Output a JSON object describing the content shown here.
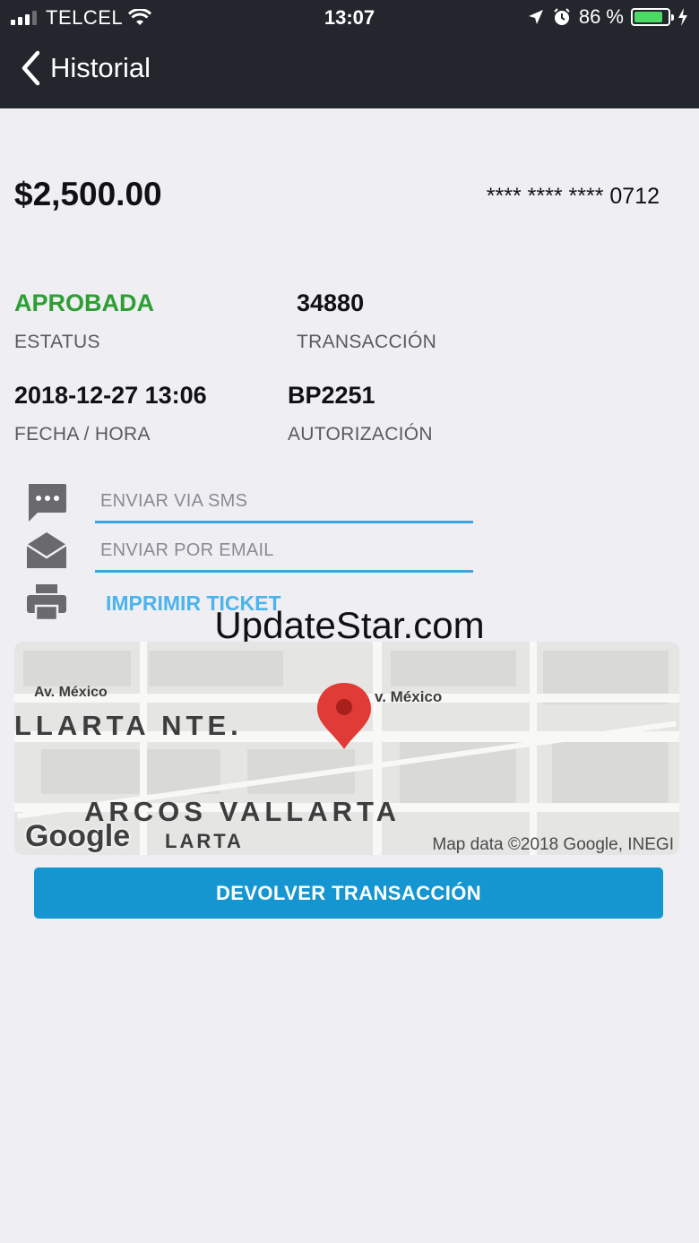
{
  "status_bar": {
    "carrier": "TELCEL",
    "time": "13:07",
    "battery": "86 %"
  },
  "nav": {
    "back_label": "Historial"
  },
  "transaction": {
    "amount": "$2,500.00",
    "card": "**** **** **** 0712",
    "status_value": "APROBADA",
    "status_caption": "ESTATUS",
    "transaction_value": "34880",
    "transaction_caption": "TRANSACCIÓN",
    "datetime_value": "2018-12-27 13:06",
    "datetime_caption": "FECHA / HORA",
    "auth_value": "BP2251",
    "auth_caption": "AUTORIZACIÓN"
  },
  "actions": {
    "sms_placeholder": "ENVIAR VIA SMS",
    "email_placeholder": "ENVIAR POR EMAIL",
    "print_label": "IMPRIMIR TICKET"
  },
  "watermark": "UpdateStar.com",
  "map": {
    "labels": [
      "Av. México",
      "v. México",
      "LLARTA NTE.",
      "ARCOS VALLARTA",
      "LARTA"
    ],
    "logo": "Google",
    "attribution": "Map data ©2018 Google, INEGI"
  },
  "refund_button": "DEVOLVER TRANSACCIÓN",
  "colors": {
    "accent": "#1596d1",
    "approved": "#2e9e35",
    "link": "#4bb4ec",
    "header": "#24262d"
  }
}
